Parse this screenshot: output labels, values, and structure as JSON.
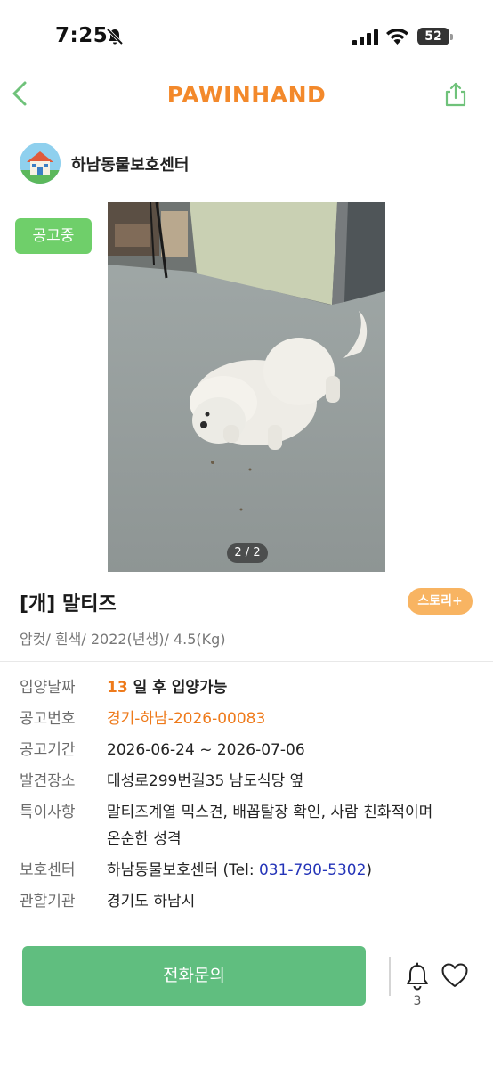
{
  "status_bar": {
    "time": "7:25",
    "battery": "52"
  },
  "header": {
    "brand": "PAWINHAND"
  },
  "shelter": {
    "name": "하남동물보호센터"
  },
  "listing": {
    "badge": "공고중",
    "photo_counter": "2 / 2",
    "title": "[개] 말티즈",
    "story_button": "스토리+",
    "subtitle": "암컷/ 흰색/ 2022(년생)/ 4.5(Kg)"
  },
  "info": {
    "adoption_date": {
      "label": "입양날짜",
      "days": "13",
      "suffix": "일 후 입양가능"
    },
    "notice_number": {
      "label": "공고번호",
      "value": "경기-하남-2026-00083"
    },
    "notice_period": {
      "label": "공고기간",
      "value": "2026-06-24 ~ 2026-07-06"
    },
    "found_place": {
      "label": "발견장소",
      "value": "대성로299번길35 남도식당 옆"
    },
    "notes": {
      "label": "특이사항",
      "line1": "말티즈계열 믹스견, 배꼽탈장 확인, 사람 친화적이며",
      "line2": "온순한 성격"
    },
    "shelter": {
      "label": "보호센터",
      "name": "하남동물보호센터 (Tel: ",
      "tel": "031-790-5302",
      "close": ")"
    },
    "jurisdiction": {
      "label": "관할기관",
      "value": "경기도 하남시"
    }
  },
  "bottom_bar": {
    "call_button": "전화문의",
    "bell_count": "3"
  },
  "icons": {
    "back": "chevron-left-icon",
    "share": "share-icon",
    "bell": "bell-icon",
    "heart": "heart-icon",
    "mute": "bell-slash-icon"
  },
  "colors": {
    "brand_orange": "#f3892b",
    "accent_green": "#60be7f",
    "badge_green": "#6fcf6a",
    "story_orange": "#f8b462",
    "value_orange": "#ee7a1b",
    "tel_blue": "#2434b8"
  }
}
